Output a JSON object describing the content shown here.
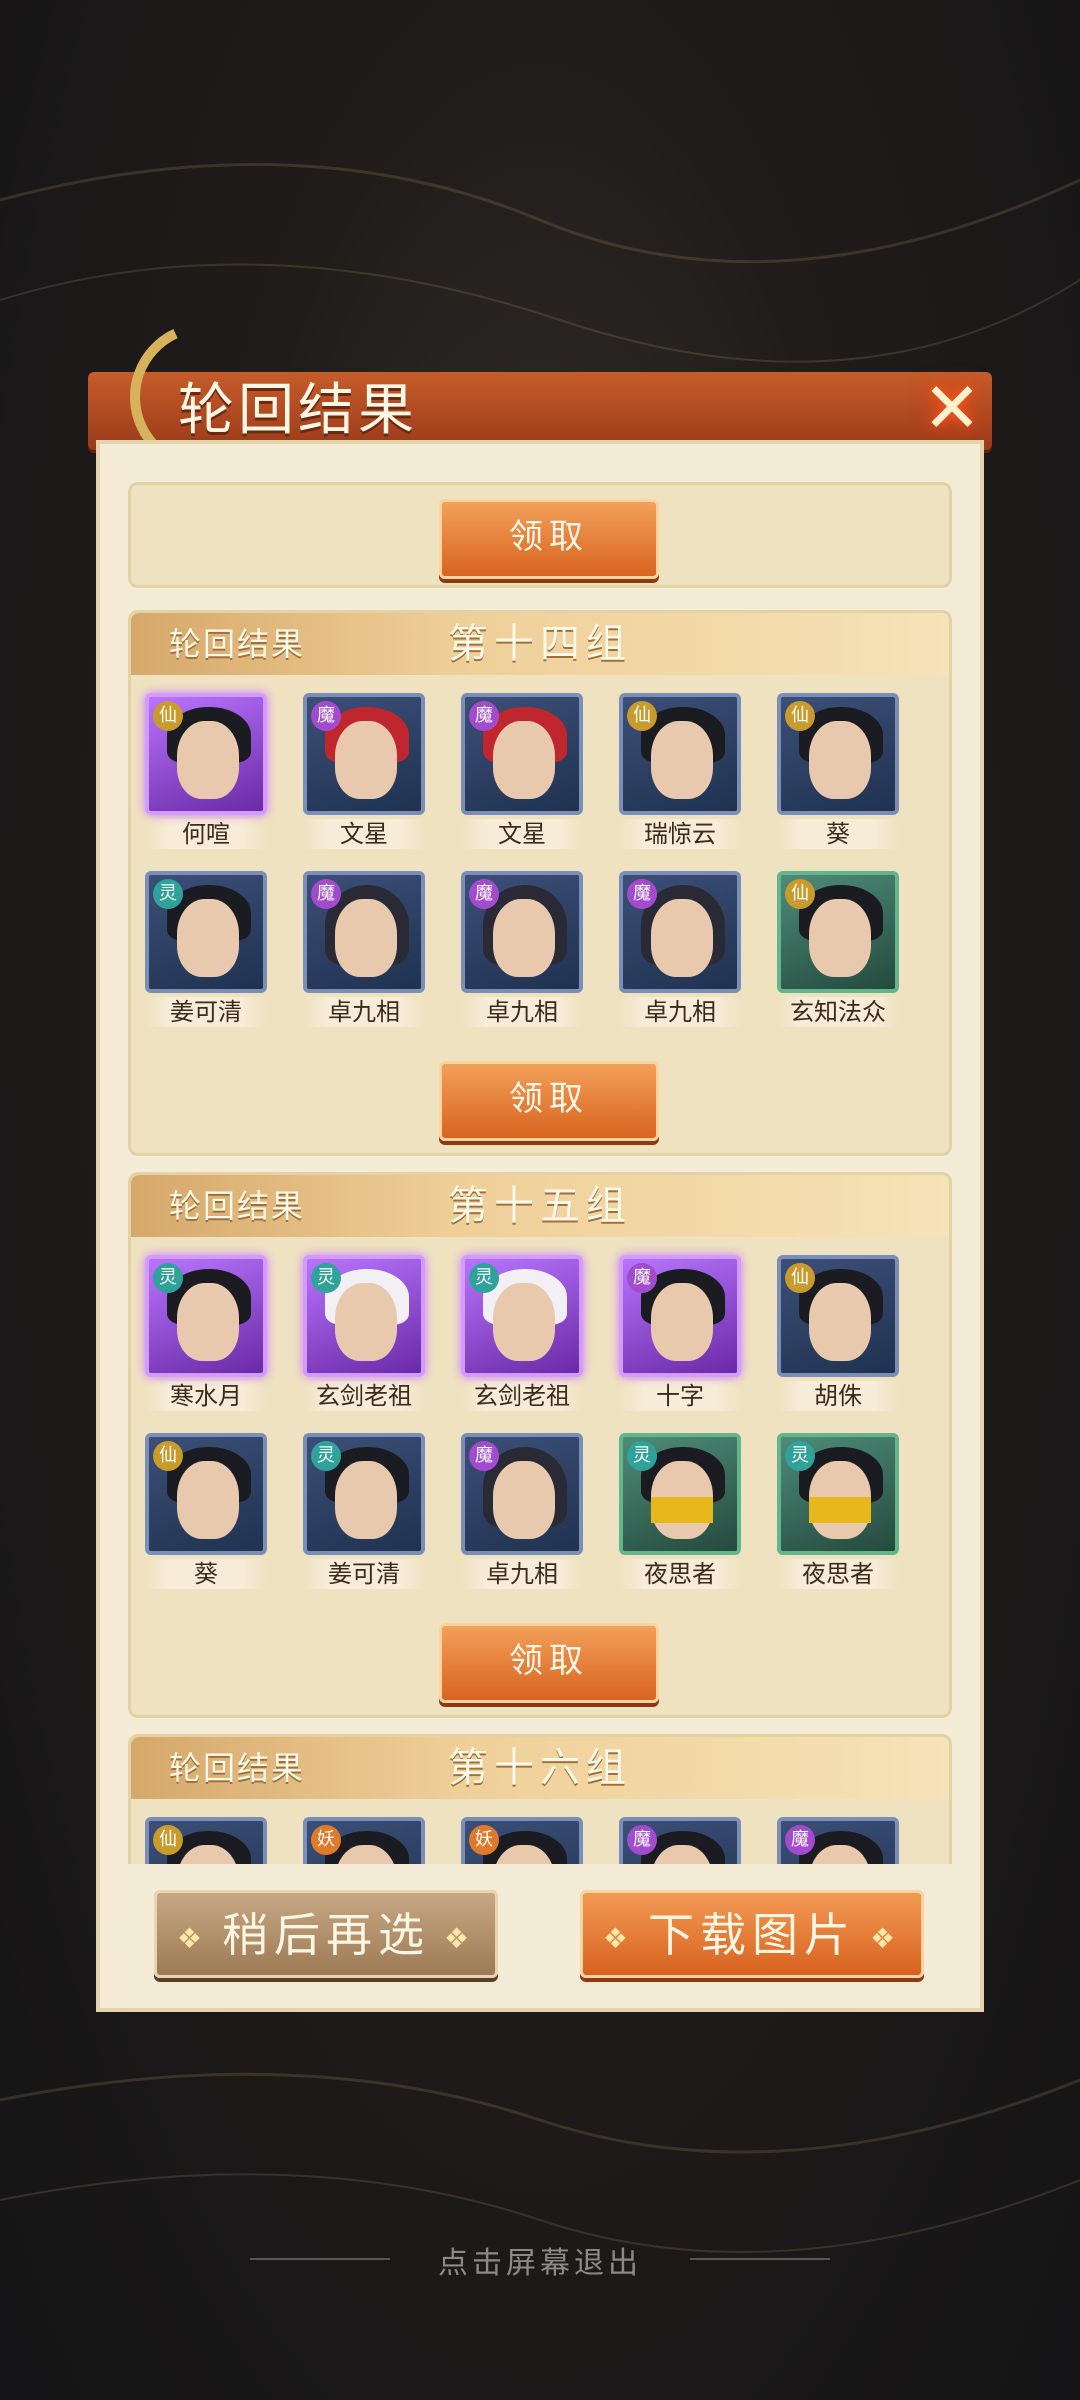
{
  "header": {
    "title": "轮回结果",
    "close_icon": "close-icon"
  },
  "cards": [
    {
      "show_head": false,
      "claim_label": "领取"
    },
    {
      "label": "轮回结果",
      "group": "第十四组",
      "claim_label": "领取",
      "heroes": [
        {
          "name": "何喧",
          "faction": "仙",
          "style": "purple"
        },
        {
          "name": "文星",
          "faction": "魔",
          "style": "blue"
        },
        {
          "name": "文星",
          "faction": "魔",
          "style": "blue"
        },
        {
          "name": "瑞惊云",
          "faction": "仙",
          "style": "blue"
        },
        {
          "name": "葵",
          "faction": "仙",
          "style": "blue"
        },
        {
          "name": "姜可清",
          "faction": "灵",
          "style": "blue"
        },
        {
          "name": "卓九相",
          "faction": "魔",
          "style": "blue"
        },
        {
          "name": "卓九相",
          "faction": "魔",
          "style": "blue"
        },
        {
          "name": "卓九相",
          "faction": "魔",
          "style": "blue"
        },
        {
          "name": "玄知法众",
          "faction": "仙",
          "style": "green"
        }
      ]
    },
    {
      "label": "轮回结果",
      "group": "第十五组",
      "claim_label": "领取",
      "heroes": [
        {
          "name": "寒水月",
          "faction": "灵",
          "style": "purple"
        },
        {
          "name": "玄剑老祖",
          "faction": "灵",
          "style": "purple"
        },
        {
          "name": "玄剑老祖",
          "faction": "灵",
          "style": "purple"
        },
        {
          "name": "十字",
          "faction": "魔",
          "style": "purple"
        },
        {
          "name": "胡侏",
          "faction": "仙",
          "style": "blue"
        },
        {
          "name": "葵",
          "faction": "仙",
          "style": "blue"
        },
        {
          "name": "姜可清",
          "faction": "灵",
          "style": "blue"
        },
        {
          "name": "卓九相",
          "faction": "魔",
          "style": "blue"
        },
        {
          "name": "夜思者",
          "faction": "灵",
          "style": "green"
        },
        {
          "name": "夜思者",
          "faction": "灵",
          "style": "green"
        }
      ]
    },
    {
      "label": "轮回结果",
      "group": "第十六组",
      "heroes_partial": [
        {
          "faction": "仙"
        },
        {
          "faction": "妖"
        },
        {
          "faction": "妖"
        },
        {
          "faction": "魔"
        },
        {
          "faction": "魔"
        }
      ]
    }
  ],
  "buttons": {
    "later": "稍后再选",
    "download": "下载图片",
    "diamond": "❖"
  },
  "footer": {
    "exit_hint": "点击屏幕退出"
  }
}
